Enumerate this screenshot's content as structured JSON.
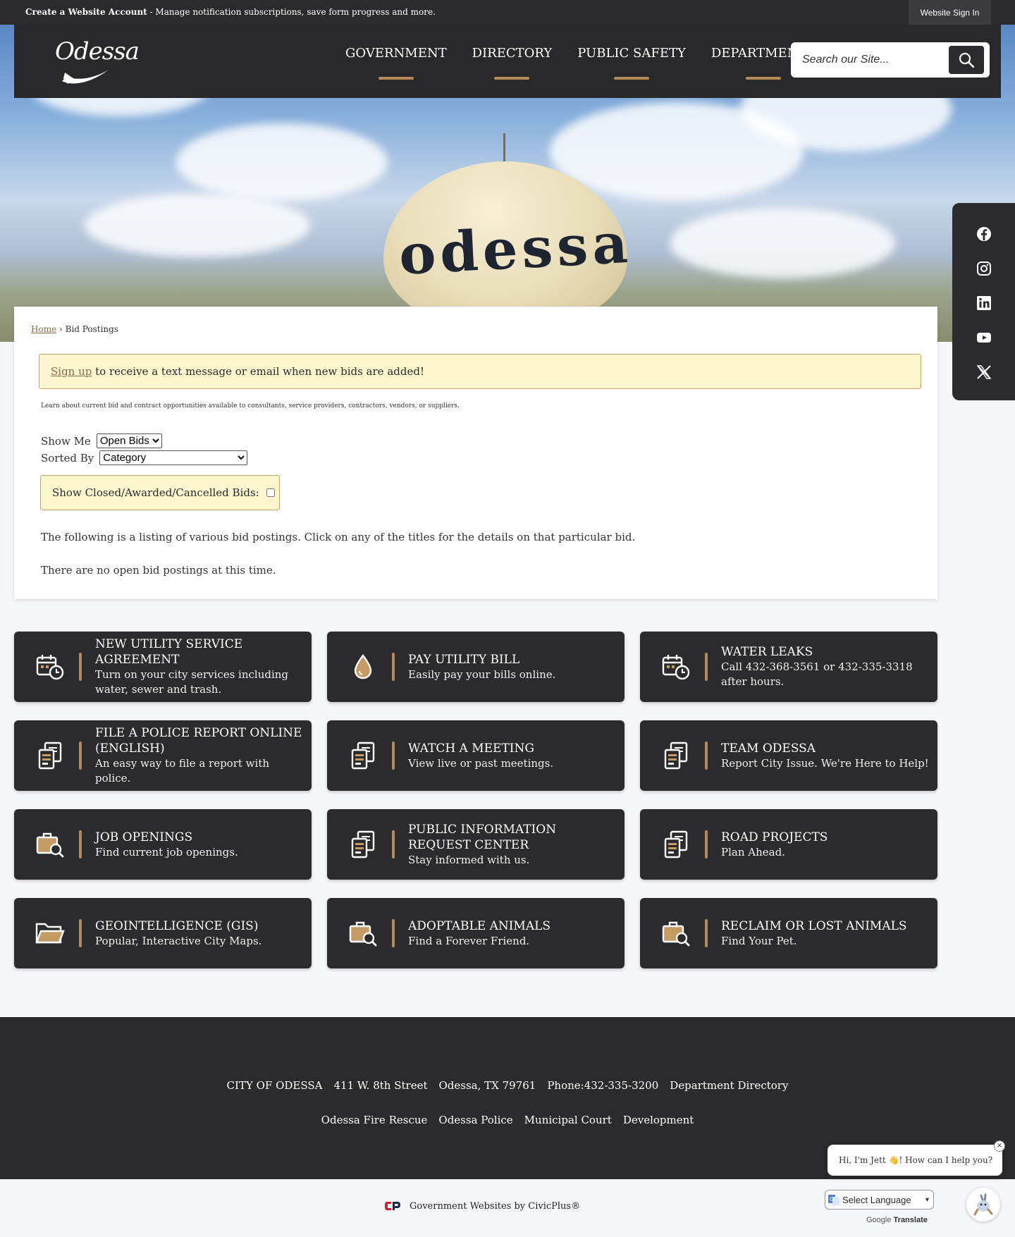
{
  "topbar": {
    "create_account_bold": "Create a Website Account",
    "create_account_rest": " - Manage notification subscriptions, save form progress and more.",
    "sign_in": "Website Sign In"
  },
  "header": {
    "logo_text": "Odessa",
    "nav": [
      "GOVERNMENT",
      "DIRECTORY",
      "PUBLIC SAFETY",
      "DEPARTMENTS"
    ],
    "search_placeholder": "Search our Site..."
  },
  "hero": {
    "tower_text": "odessa"
  },
  "social": [
    "facebook",
    "instagram",
    "linkedin",
    "youtube",
    "x-twitter"
  ],
  "breadcrumb": {
    "home": "Home",
    "separator": "›",
    "current": "Bid Postings"
  },
  "alert": {
    "link": "Sign up",
    "text": " to receive a text message or email when new bids are added!"
  },
  "intro": "Learn about current bid and contract opportunities available to consultants, service providers, contractors, vendors, or suppliers.",
  "filters": {
    "show_me_label": "Show Me",
    "show_me_value": "Open Bids",
    "sorted_by_label": "Sorted By",
    "sorted_by_value": "Category",
    "closed_label": "Show Closed/Awarded/Cancelled Bids:"
  },
  "listing_text": "The following is a listing of various bid postings. Click on any of the titles for the details on that particular bid.",
  "no_bids_text": "There are no open bid postings at this time.",
  "tiles": [
    {
      "title": "NEW UTILITY SERVICE AGREEMENT",
      "desc": "Turn on your city services including water, sewer and trash.",
      "icon": "calendar-clock-icon"
    },
    {
      "title": "PAY UTILITY BILL",
      "desc": "Easily pay your bills online.",
      "icon": "water-drop-icon"
    },
    {
      "title": "WATER LEAKS",
      "desc": "Call 432-368-3561 or 432-335-3318 after hours.",
      "icon": "calendar-clock-icon"
    },
    {
      "title": "FILE A POLICE REPORT ONLINE (ENGLISH)",
      "desc": "An easy way to file a report with police.",
      "icon": "documents-icon"
    },
    {
      "title": "WATCH A MEETING",
      "desc": "View live or past meetings.",
      "icon": "documents-icon"
    },
    {
      "title": "TEAM ODESSA",
      "desc": "Report City Issue. We're Here to Help!",
      "icon": "documents-icon"
    },
    {
      "title": "JOB OPENINGS",
      "desc": "Find current job openings.",
      "icon": "briefcase-search-icon"
    },
    {
      "title": "PUBLIC INFORMATION REQUEST CENTER",
      "desc": "Stay informed with us.",
      "icon": "documents-icon"
    },
    {
      "title": "ROAD PROJECTS",
      "desc": "Plan Ahead.",
      "icon": "documents-icon"
    },
    {
      "title": "GEOINTELLIGENCE (GIS)",
      "desc": "Popular, Interactive City Maps.",
      "icon": "folder-icon"
    },
    {
      "title": "ADOPTABLE ANIMALS",
      "desc": "Find a Forever Friend.",
      "icon": "briefcase-search-icon"
    },
    {
      "title": "RECLAIM OR LOST ANIMALS",
      "desc": "Find Your Pet.",
      "icon": "briefcase-search-icon"
    }
  ],
  "footer": {
    "row1": [
      "CITY OF ODESSA",
      "411 W. 8th Street",
      "Odessa, TX 79761",
      "Phone:432-335-3200",
      "Department Directory"
    ],
    "row2": [
      "Odessa Fire Rescue",
      "Odessa Police",
      "Municipal Court",
      "Development"
    ]
  },
  "bottom": {
    "civicplus": "Government Websites by CivicPlus®",
    "translate_select": "Select Language",
    "translate_google": "Google",
    "translate_label": "Translate"
  },
  "chat": {
    "message": "Hi, I'm Jett 👋! How can I help you?",
    "close": "×"
  },
  "colors": {
    "dark": "#2b2b2d",
    "accent": "#b38a5a",
    "alert_bg": "#fcf6cf"
  }
}
